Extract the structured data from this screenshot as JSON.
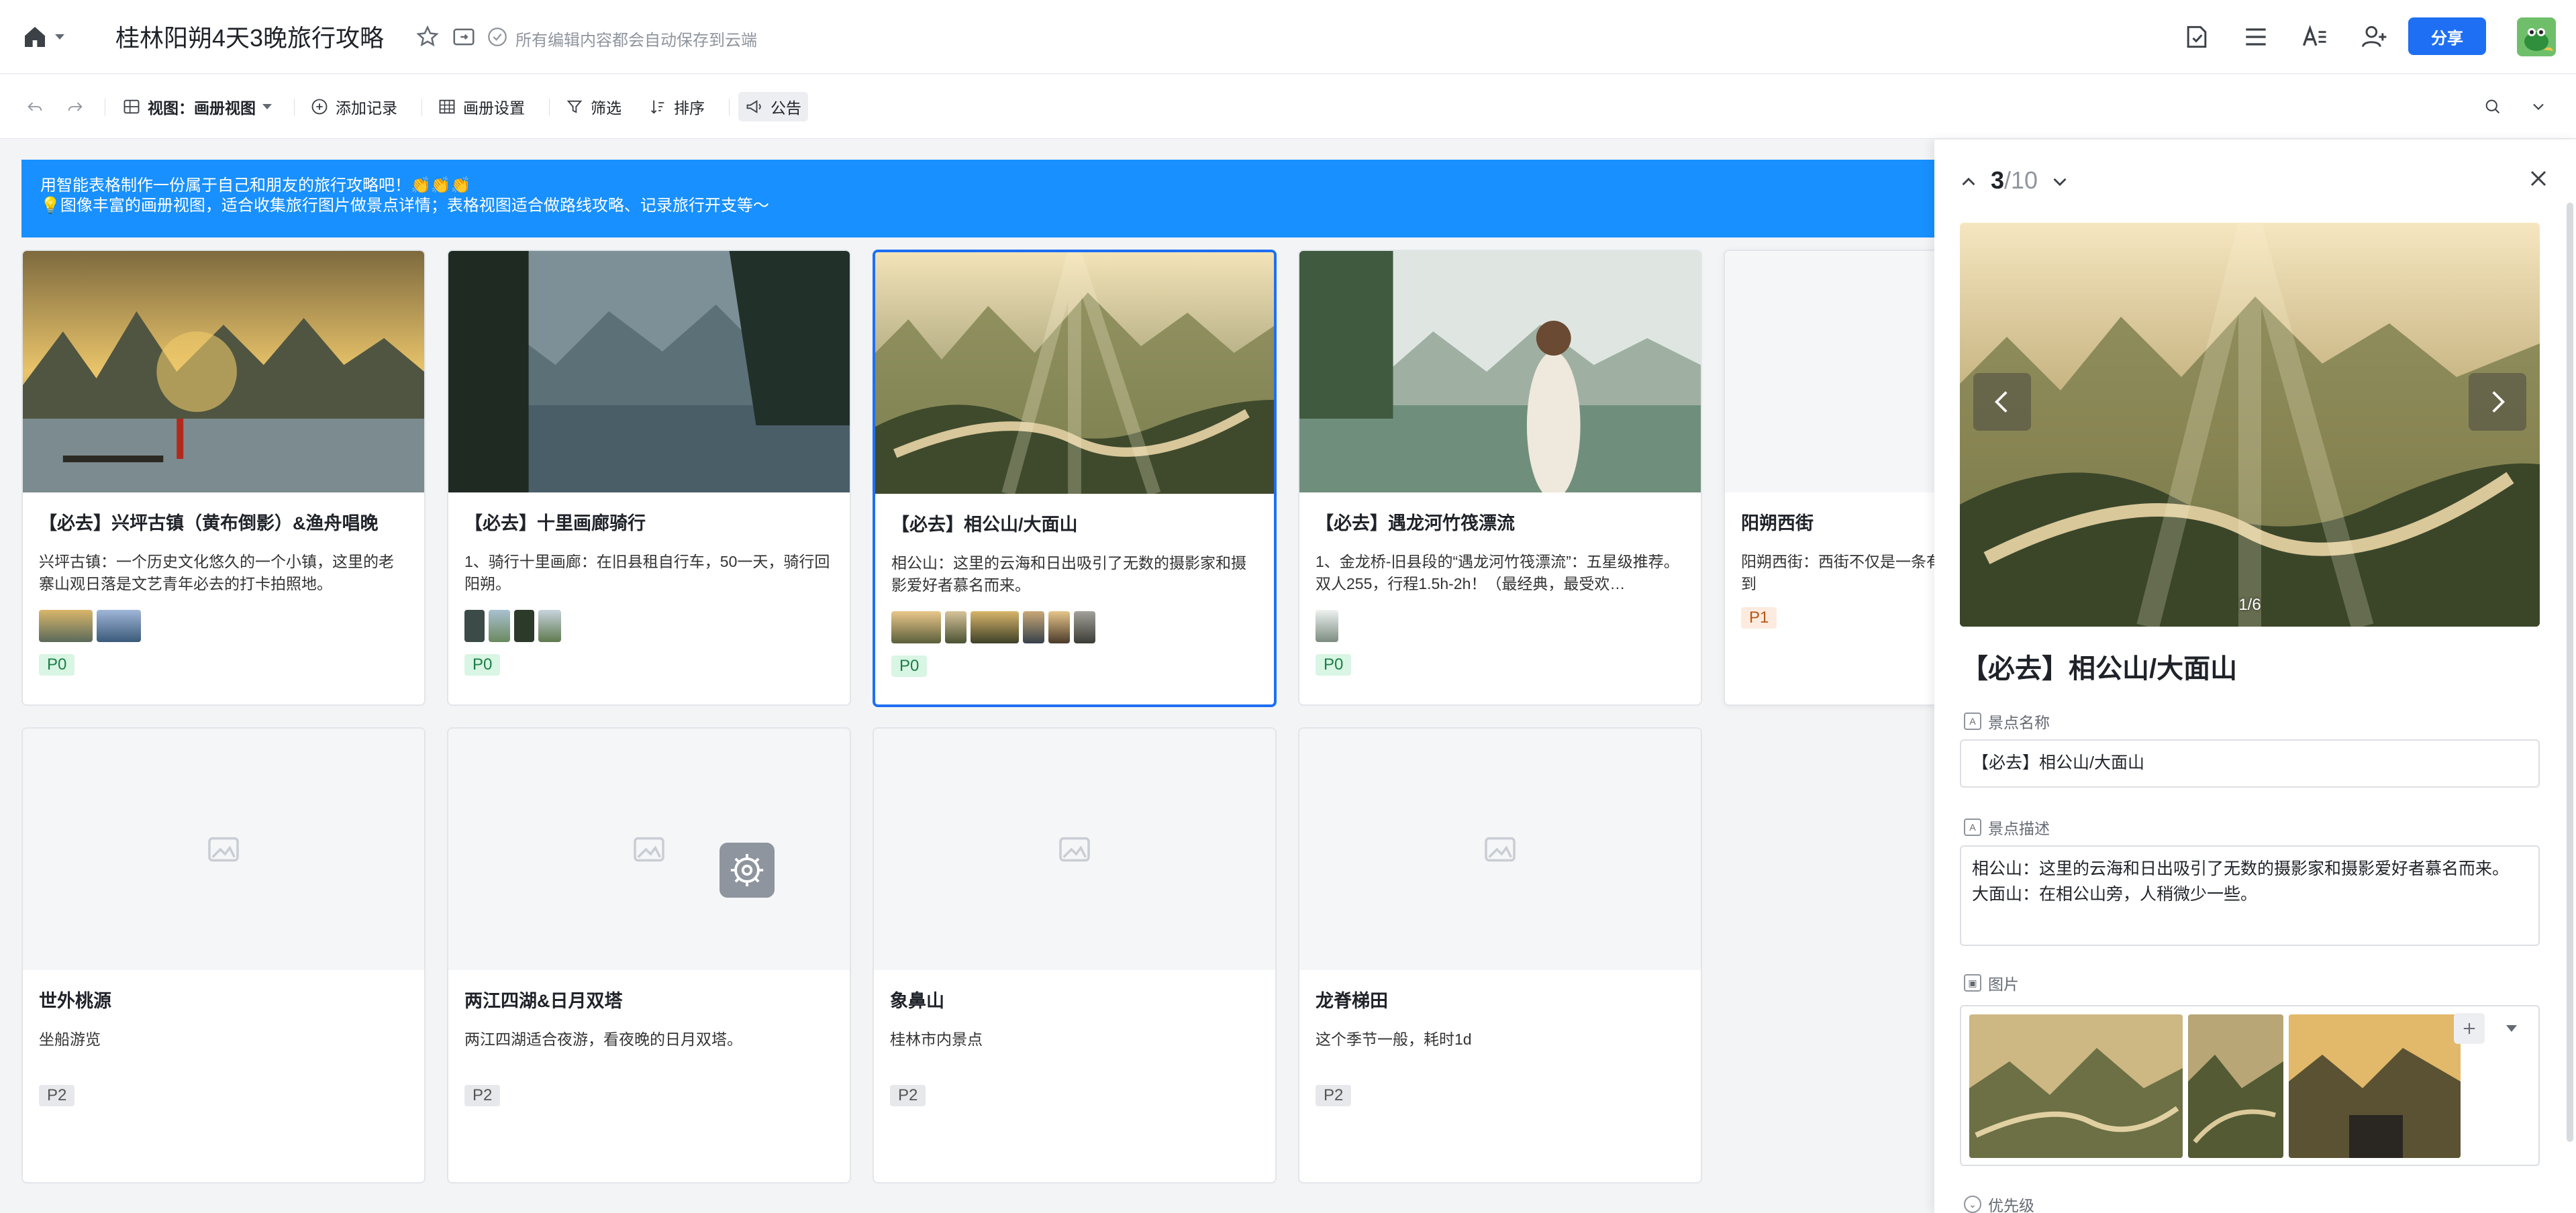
{
  "header": {
    "title": "桂林阳朔4天3晚旅行攻略",
    "save_status": "所有编辑内容都会自动保存到云端",
    "share_label": "分享"
  },
  "toolbar": {
    "view_label": "视图：画册视图",
    "add_record": "添加记录",
    "album_settings": "画册设置",
    "filter": "筛选",
    "sort": "排序",
    "announcement": "公告"
  },
  "banner": {
    "line1": "用智能表格制作一份属于自己和朋友的旅行攻略吧！👏👏👏",
    "line2": "💡图像丰富的画册视图，适合收集旅行图片做景点详情；表格视图适合做路线攻略、记录旅行开支等～"
  },
  "cards": [
    {
      "name": "【必去】兴坪古镇（黄布倒影）&渔舟唱晚",
      "desc": "兴坪古镇：一个历史文化悠久的一个小镇，这里的老寨山观日落是文艺青年必去的打卡拍照地。",
      "tag": "P0"
    },
    {
      "name": "【必去】十里画廊骑行",
      "desc": "1、骑行十里画廊：在旧县租自行车，50一天，骑行回阳朔。",
      "tag": "P0"
    },
    {
      "name": "【必去】相公山/大面山",
      "desc": "相公山：这里的云海和日出吸引了无数的摄影家和摄影爱好者慕名而来。",
      "tag": "P0"
    },
    {
      "name": "【必去】遇龙河竹筏漂流",
      "desc": "1、金龙桥-旧县段的“遇龙河竹筏漂流”：五星级推荐。双人255，行程1.5h-2h！（最经典，最受欢…",
      "tag": "P0"
    },
    {
      "name": "阳朔西街",
      "desc": "阳朔西街：西街不仅是一条有百年商铺的文化街，来到",
      "tag": "P1"
    },
    {
      "name": "世外桃源",
      "desc": "坐船游览",
      "tag": "P2"
    },
    {
      "name": "两江四湖&日月双塔",
      "desc": "两江四湖适合夜游，看夜晚的日月双塔。",
      "tag": "P2"
    },
    {
      "name": "象鼻山",
      "desc": "桂林市内景点",
      "tag": "P2"
    },
    {
      "name": "龙脊梯田",
      "desc": "这个季节一般，耗时1d",
      "tag": "P2"
    }
  ],
  "detail": {
    "current": "3",
    "total": "/10",
    "image_counter": "1/6",
    "title": "【必去】相公山/大面山",
    "field_name_label": "景点名称",
    "field_name_value": "【必去】相公山/大面山",
    "field_desc_label": "景点描述",
    "field_desc_line1": "相公山：这里的云海和日出吸引了无数的摄影家和摄影爱好者慕名而来。",
    "field_desc_line2": "大面山：在相公山旁，人稍微少一些。",
    "field_images_label": "图片",
    "field_priority_label": "优先级"
  },
  "colors": {
    "accent": "#1e6ff3",
    "banner": "#1890ff",
    "tag_p0_bg": "#d9f5e4",
    "tag_p1_bg": "#fdebe0",
    "tag_p2_bg": "#e6e8eb"
  }
}
